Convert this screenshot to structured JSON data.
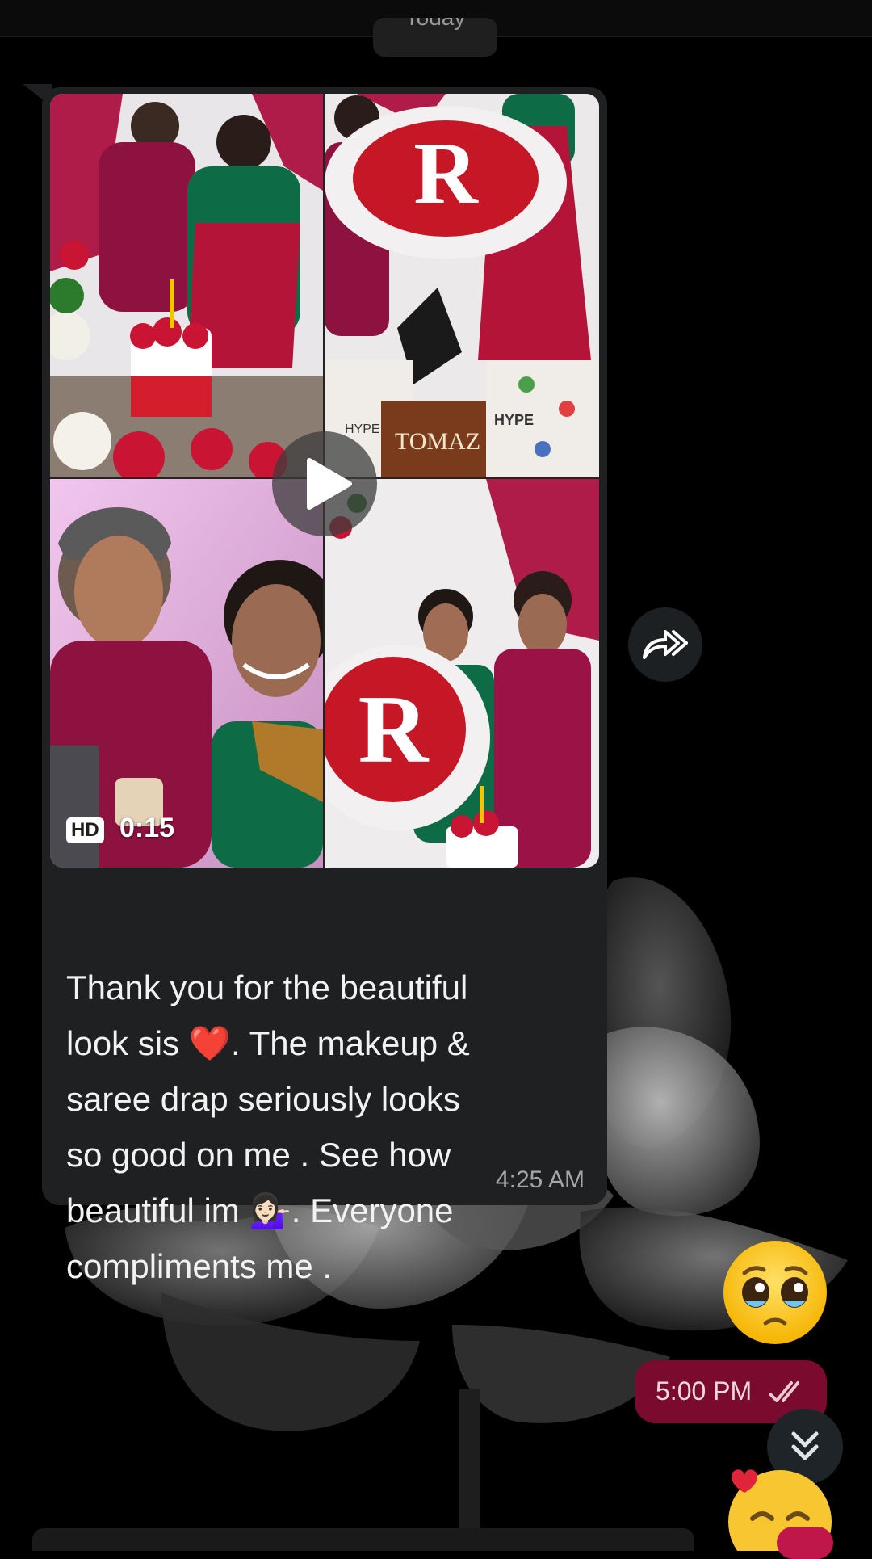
{
  "chat": {
    "date_chip": "Today"
  },
  "incoming": {
    "media": {
      "hd_label": "HD",
      "duration": "0:15",
      "bag_text_left": "HYPE",
      "bag_text_right": "HYPE",
      "brand_bag": "TOMAZ",
      "play_icon": "play-icon"
    },
    "text_lines": [
      "Thank you for the beautiful",
      "look sis ❤️. The makeup &",
      "saree drap seriously looks",
      "so good on me . See how",
      "beautiful im 💁🏻‍♀️. Everyone",
      "compliments me ."
    ],
    "time": "4:25 AM"
  },
  "outgoing": {
    "emoji": "🥹",
    "time": "5:00 PM",
    "status_icon": "double-check-icon"
  },
  "controls": {
    "forward_icon": "forward-icon",
    "scroll_down_icon": "chevron-double-down-icon"
  },
  "colors": {
    "background": "#000000",
    "incoming_bubble": "#1f2021",
    "outgoing_bubble": "#7a0a2e",
    "accent": "#c0174a"
  }
}
